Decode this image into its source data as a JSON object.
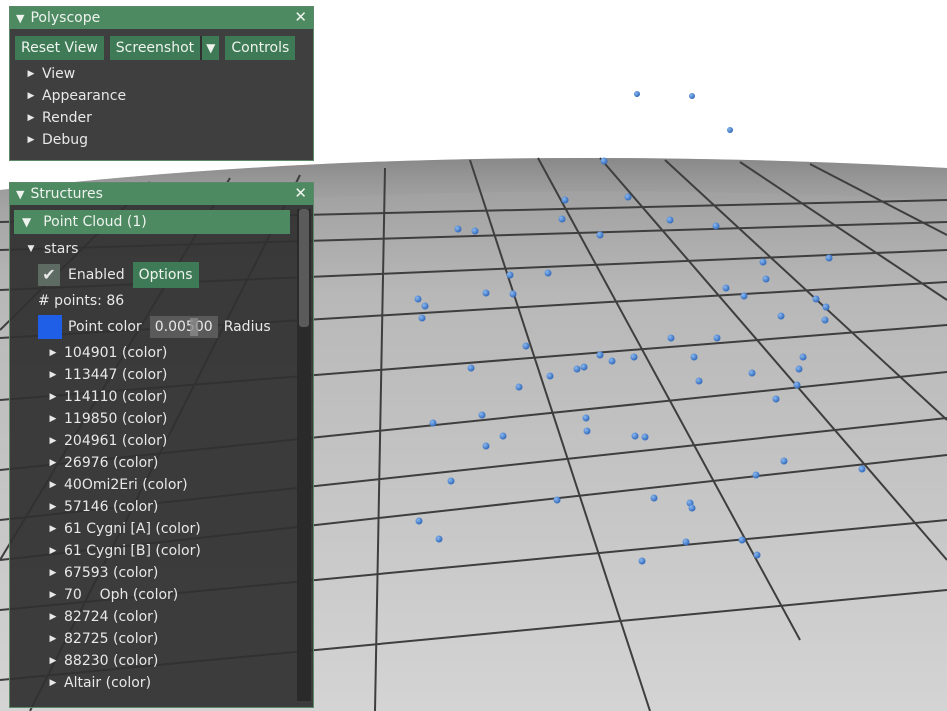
{
  "polyscope": {
    "title": "Polyscope",
    "buttons": {
      "reset_view": "Reset View",
      "screenshot": "Screenshot",
      "controls": "Controls"
    },
    "menu": [
      "View",
      "Appearance",
      "Render",
      "Debug"
    ]
  },
  "structures": {
    "title": "Structures",
    "group_header": "Point Cloud (1)",
    "cloud_name": "stars",
    "enabled_label": "Enabled",
    "options_label": "Options",
    "points_label": "# points: 86",
    "point_color_label": "Point color",
    "point_color": "#1f5fe8",
    "radius_value": "0.00500",
    "radius_label": "Radius",
    "quantities": [
      "104901 (color)",
      "113447 (color)",
      "114110 (color)",
      "119850 (color)",
      "204961 (color)",
      "26976 (color)",
      "40Omi2Eri (color)",
      "57146 (color)",
      "61 Cygni [A] (color)",
      "61 Cygni [B] (color)",
      "67593 (color)",
      "70    Oph (color)",
      "82724 (color)",
      "82725 (color)",
      "88230 (color)",
      "Altair (color)"
    ]
  },
  "colors": {
    "accent": "#4d8a62",
    "button": "#3f7a56",
    "point": "#3a7fd0",
    "panel": "#303030"
  }
}
